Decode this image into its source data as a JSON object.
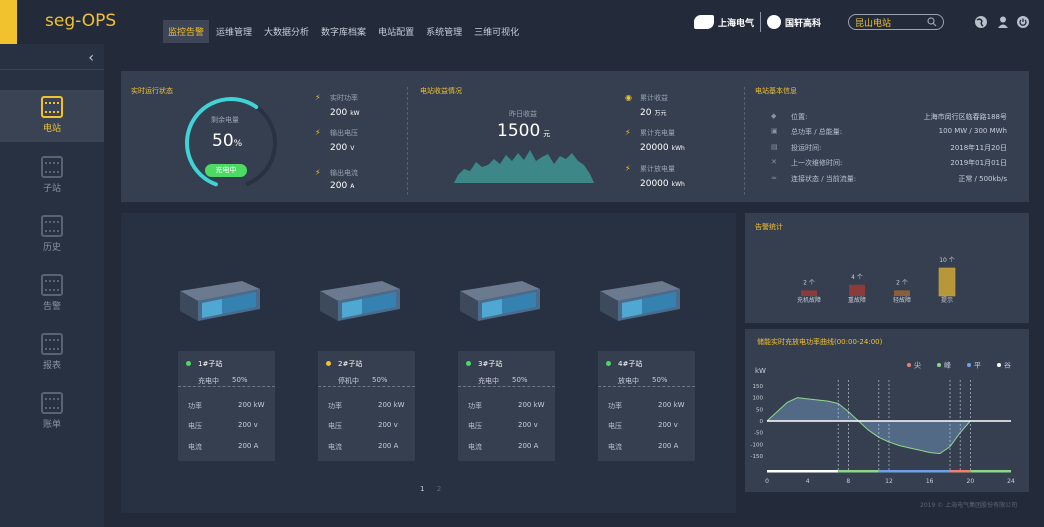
{
  "app": {
    "title": "seg-OPS"
  },
  "nav": [
    "监控告警",
    "运维管理",
    "大数据分析",
    "数字库档案",
    "电站配置",
    "系统管理",
    "三维可视化"
  ],
  "brands": {
    "a": "上海电气",
    "b": "国轩高科"
  },
  "search": {
    "value": "昆山电站"
  },
  "sidebar": {
    "items": [
      "电站",
      "子站",
      "历史",
      "告警",
      "报表",
      "账单"
    ]
  },
  "status": {
    "title": "实时运行状态",
    "soc_label": "剩余电量",
    "soc_value": "50",
    "soc_unit": "%",
    "charge_badge": "充电中",
    "power_label": "实时功率",
    "power_value": "200",
    "power_unit": "kW",
    "voltage_label": "输出电压",
    "voltage_value": "200",
    "voltage_unit": "V",
    "current_label": "输出电流",
    "current_value": "200",
    "current_unit": "A"
  },
  "revenue": {
    "title": "电站收益情况",
    "yesterday_label": "昨日收益",
    "yesterday_value": "1500",
    "yesterday_unit": "元",
    "cum_label": "累计收益",
    "cum_value": "20",
    "cum_unit": "万元",
    "charged_label": "累计充电量",
    "charged_value": "20000",
    "charged_unit": "kWh",
    "discharged_label": "累计放电量",
    "discharged_value": "20000",
    "discharged_unit": "kWh"
  },
  "info": {
    "title": "电站基本信息",
    "rows": [
      {
        "label": "位置:",
        "value": "上海市闵行区临春路188号"
      },
      {
        "label": "总功率 / 总能量:",
        "value": "100 MW / 300 MWh"
      },
      {
        "label": "投运时间:",
        "value": "2018年11月20日"
      },
      {
        "label": "上一次维修时间:",
        "value": "2019年01月01日"
      },
      {
        "label": "连接状态 / 当前流量:",
        "value": "正常 / 500kb/s"
      }
    ]
  },
  "stations": [
    {
      "name": "1#子站",
      "state": "充电中",
      "pct": "50%",
      "dot": "#4cd964",
      "power": "200 kW",
      "voltage": "200 v",
      "current": "200 A"
    },
    {
      "name": "2#子站",
      "state": "停机中",
      "pct": "50%",
      "dot": "#f2c12e",
      "power": "200 kW",
      "voltage": "200 v",
      "current": "200 A"
    },
    {
      "name": "3#子站",
      "state": "充电中",
      "pct": "50%",
      "dot": "#4cd964",
      "power": "200 kW",
      "voltage": "200 v",
      "current": "200 A"
    },
    {
      "name": "4#子站",
      "state": "放电中",
      "pct": "50%",
      "dot": "#4cd964",
      "power": "200 kW",
      "voltage": "200 v",
      "current": "200 A"
    }
  ],
  "card_labels": {
    "power": "功率",
    "voltage": "电压",
    "current": "电流"
  },
  "pagination": [
    "1",
    "2"
  ],
  "alarm": {
    "title": "告警统计",
    "unit": "个",
    "items": [
      {
        "name": "充机故障",
        "count": 2,
        "color": "#8c3a3a"
      },
      {
        "name": "重故障",
        "count": 4,
        "color": "#8c3a3a"
      },
      {
        "name": "轻故障",
        "count": 2,
        "color": "#8c5e3a"
      },
      {
        "name": "提示",
        "count": 10,
        "color": "#b8963a"
      }
    ]
  },
  "chart_data": {
    "type": "line",
    "title": "储能实时充放电功率曲线(00:00-24:00)",
    "ylabel": "kW",
    "ylim": [
      -150,
      150
    ],
    "xlim": [
      0,
      24
    ],
    "xticks": [
      0,
      4,
      8,
      12,
      16,
      20,
      24
    ],
    "yticks": [
      150,
      100,
      50,
      0,
      -50,
      -100,
      -150
    ],
    "legend": [
      "尖",
      "峰",
      "平",
      "谷"
    ],
    "legend_colors": [
      "#e8836f",
      "#8fd68b",
      "#6fa0e8",
      "#ffffff"
    ],
    "x": [
      0,
      1,
      2,
      3,
      4,
      5,
      6,
      7,
      8,
      9,
      10,
      11,
      12,
      13,
      14,
      15,
      16,
      17,
      18,
      19,
      20
    ],
    "values": [
      0,
      40,
      80,
      100,
      95,
      90,
      85,
      75,
      40,
      0,
      -40,
      -70,
      -90,
      -105,
      -115,
      -125,
      -135,
      -140,
      -110,
      -50,
      0
    ],
    "dividers": [
      7,
      8,
      11,
      12,
      18,
      19,
      20
    ],
    "period_bar": [
      {
        "from": 0,
        "to": 7,
        "name": "谷"
      },
      {
        "from": 7,
        "to": 11,
        "name": "峰"
      },
      {
        "from": 11,
        "to": 18,
        "name": "平"
      },
      {
        "from": 18,
        "to": 20,
        "name": "尖"
      },
      {
        "from": 20,
        "to": 24,
        "name": "峰"
      }
    ]
  },
  "footer": "2019 © 上海电气集团股份有限公司"
}
